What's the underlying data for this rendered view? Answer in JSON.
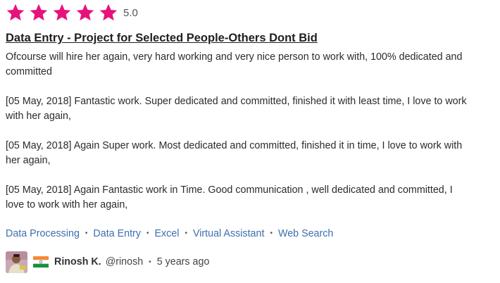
{
  "review": {
    "rating": 5,
    "rating_label": "5.0",
    "star_color": "#e8127c",
    "title": "Data Entry - Project for Selected People-Others Dont Bid",
    "paragraphs": [
      "Ofcourse will hire her again, very hard working and very nice person to work with, 100% dedicated and committed",
      "[05 May, 2018] Fantastic work. Super dedicated and committed, finished it with least time, I love to work with her again,",
      "[05 May, 2018] Again Super work. Most dedicated and committed, finished it in time, I love to work with her again,",
      "[05 May, 2018] Again Fantastic work in Time. Good communication , well dedicated and committed, I love to work with her again,"
    ],
    "skills": [
      "Data Processing",
      "Data Entry",
      "Excel",
      "Virtual Assistant",
      "Web Search"
    ],
    "skill_separator": "•",
    "link_color": "#3d6fb0",
    "reviewer": {
      "name": "Rinosh K.",
      "handle": "@rinosh",
      "separator": "•",
      "time_ago": "5 years ago",
      "country_flag_icon": "india-flag-icon",
      "avatar_icon": "reviewer-avatar"
    }
  }
}
